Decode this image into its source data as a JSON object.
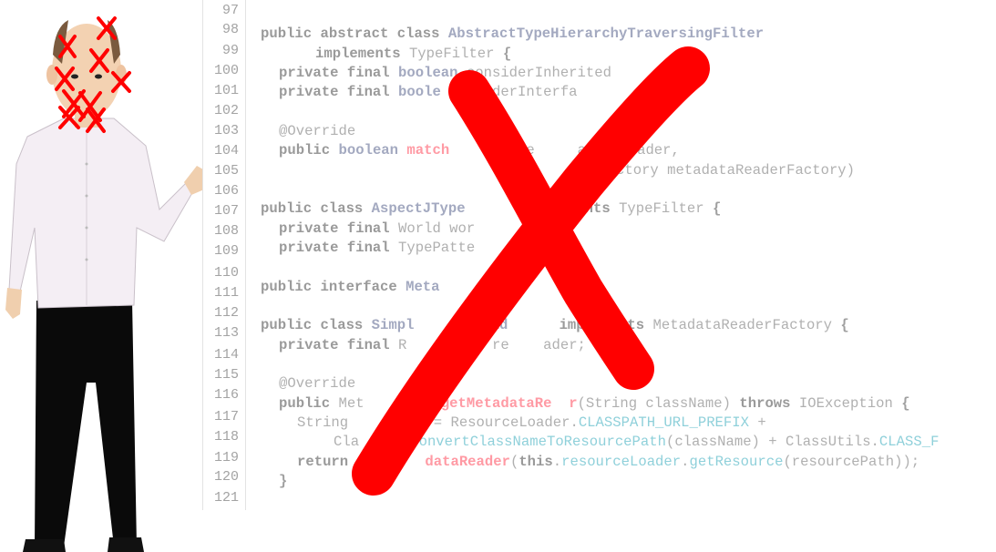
{
  "line_numbers": [
    "97",
    "98",
    "99",
    "100",
    "101",
    "102",
    "103",
    "104",
    "105",
    "106",
    "107",
    "108",
    "109",
    "110",
    "111",
    "112",
    "113",
    "114",
    "115",
    "116",
    "117",
    "118",
    "119",
    "120",
    "121"
  ],
  "code": {
    "l98": {
      "kw": "public abstract class",
      "name": "AbstractTypeHierarchyTraversingFilter"
    },
    "l99": {
      "kw": "implements",
      "type": "TypeFilter",
      "brace": "{"
    },
    "l100": {
      "kw": "private final",
      "type": "boolean",
      "rest": "considerInherited"
    },
    "l101": {
      "kw": "private final",
      "type": "boole",
      "rest": "nsiderInterfa"
    },
    "l103": {
      "ann": "@Override"
    },
    "l104": {
      "kw": "public",
      "type": "boolean",
      "method": "match",
      "rest": "aReade",
      "rest2": "adataReader,"
    },
    "l105": {
      "rest": "ctory metadataReaderFactory)"
    },
    "l107": {
      "kw": "public class",
      "name": "AspectJType",
      "kw2": "mplements",
      "type": "TypeFilter",
      "brace": "{"
    },
    "l108": {
      "kw": "private final",
      "rest": "World wor"
    },
    "l109": {
      "kw": "private final",
      "rest": "TypePatte",
      "rest2": "ern;"
    },
    "l111": {
      "kw": "public interface",
      "name": "Meta"
    },
    "l113_kw": "public class",
    "l112": {
      "kw": "public class",
      "name": "Simpl",
      "name2": "Read",
      "kw2": "implements",
      "type": "MetadataReaderFactory",
      "brace": "{"
    },
    "l113": {
      "kw": "private final",
      "rest": "R",
      "rest2": "ader re",
      "rest3": "ader;"
    },
    "l115": {
      "ann": "@Override"
    },
    "l116": {
      "kw": "public",
      "type": "Met",
      "method": "getMetadataRe",
      "method2": "r",
      "args": "(String className)",
      "kw2": "throws",
      "type2": "IOException",
      "brace": "{"
    },
    "l117": {
      "type": "String",
      "rest": "ath = ResourceLoader.",
      "const": "CLASSPATH_URL_PREFIX",
      "op": "+"
    },
    "l118": {
      "rest": "Cla",
      "method": "convertClassNameToResourcePath",
      "args": "(className) + ClassUtils.",
      "const": "CLASS_F"
    },
    "l119": {
      "kw": "return",
      "method": "dataReader",
      "args": "(",
      "kw2": "this",
      ".": ".",
      "field": "resourceLoader",
      "dot": ".",
      "method2": "getResource",
      "args2": "(resourcePath));"
    },
    "l120": {
      "brace": "}"
    }
  },
  "colors": {
    "cross": "#ff0000",
    "background": "#ffffff"
  },
  "icons": [
    "presenter-figure",
    "red-x-mark"
  ]
}
